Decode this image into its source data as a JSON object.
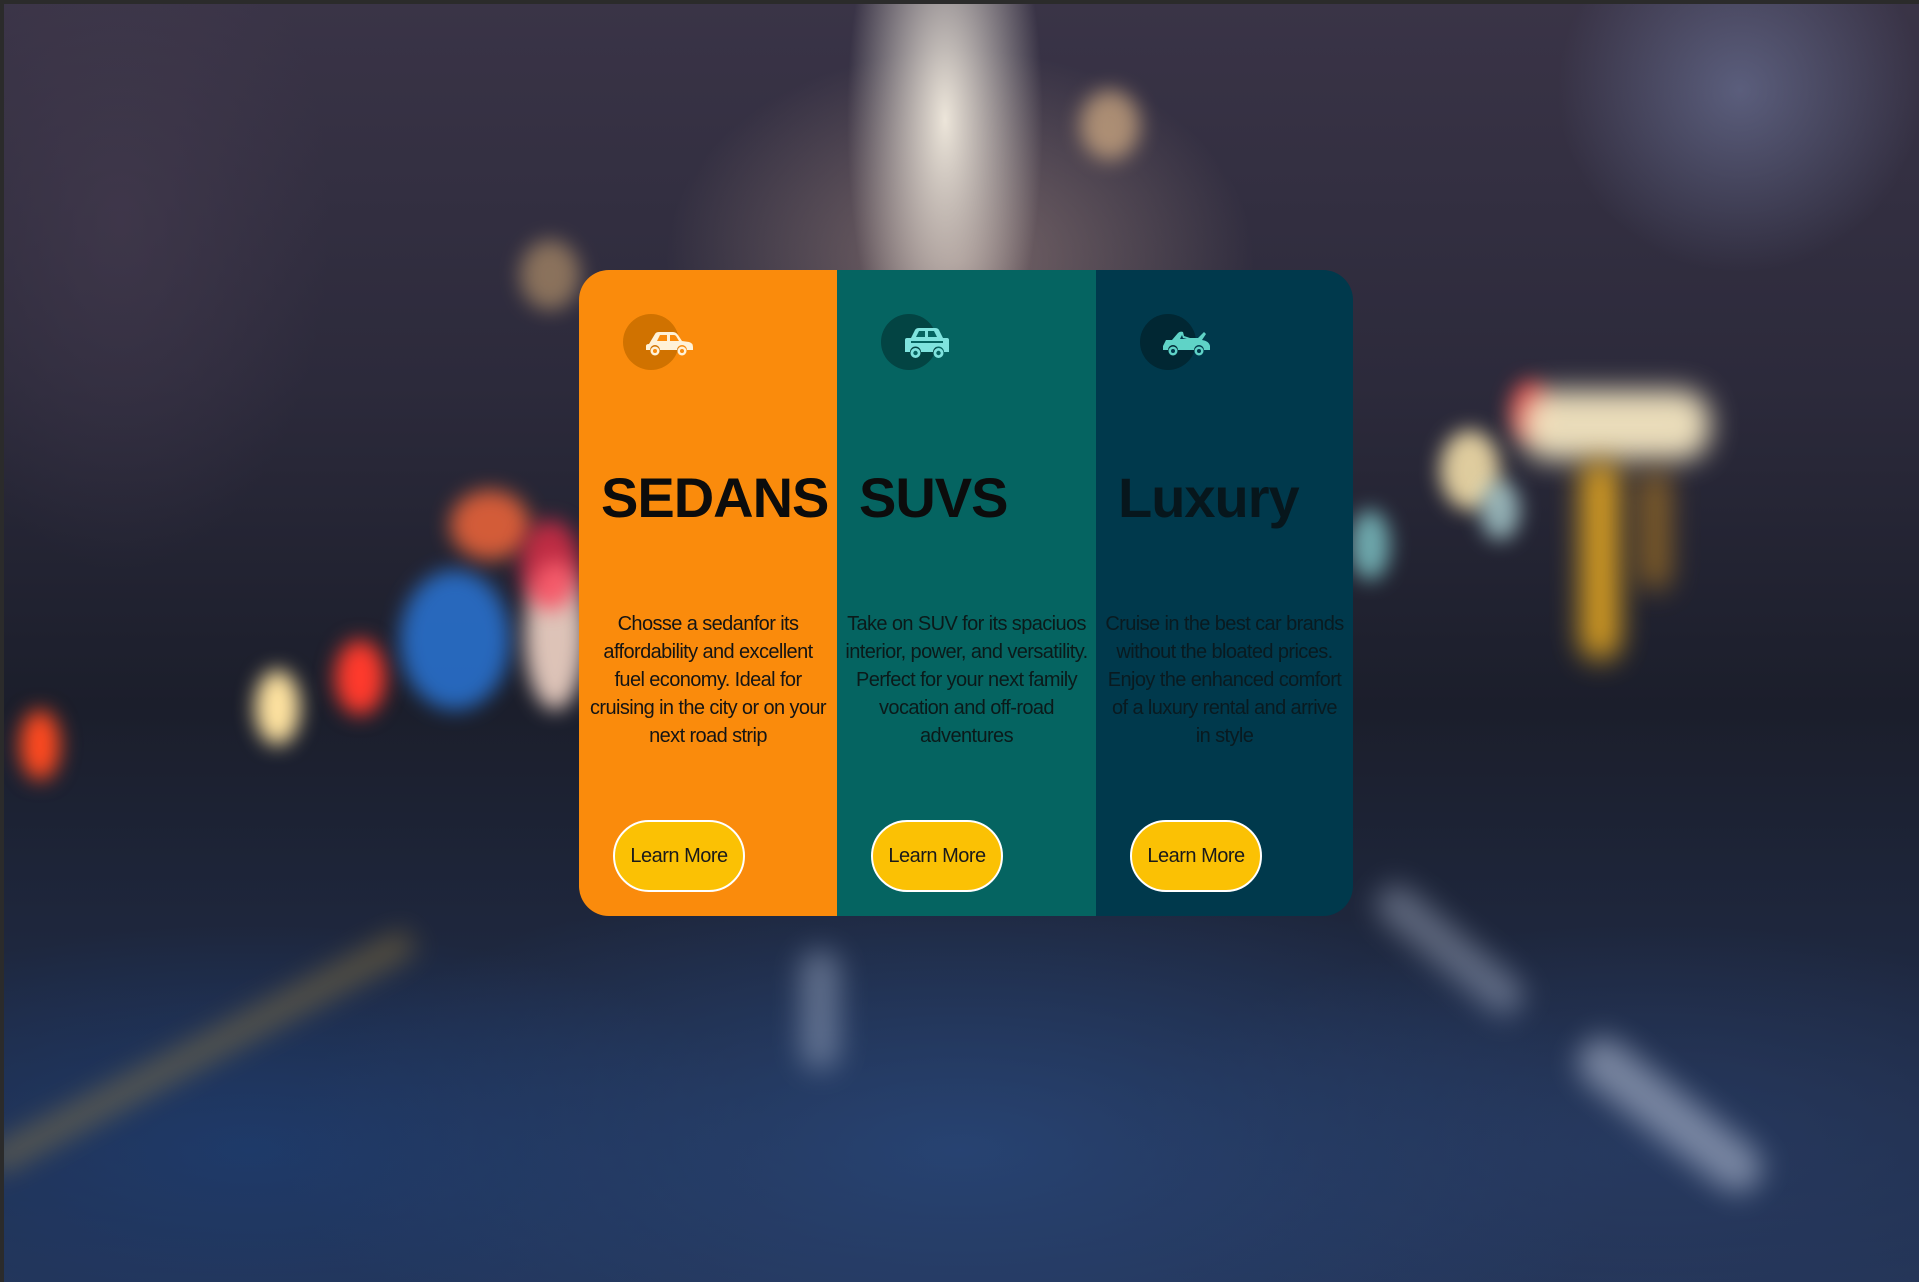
{
  "colors": {
    "sedan_bg": "#fa8b0c",
    "suv_bg": "#056461",
    "luxury_bg": "#00394c",
    "button_bg": "#fbc104",
    "button_border": "#ffffff"
  },
  "cards": [
    {
      "icon": "sedan-car-icon",
      "title": "SEDANS",
      "description": "Chosse a sedanfor its affordability and excellent fuel economy. Ideal for cruising in the city or on your next road strip",
      "button_label": "Learn More"
    },
    {
      "icon": "suv-car-icon",
      "title": "SUVS",
      "description": "Take on SUV for its spaciuos interior, power, and versatility. Perfect for your next family vocation and off-road adventures",
      "button_label": "Learn More"
    },
    {
      "icon": "luxury-car-icon",
      "title": "Luxury",
      "description": "Cruise in the best car brands without the bloated prices. Enjoy the enhanced comfort of a luxury rental and arrive in style",
      "button_label": "Learn More"
    }
  ]
}
